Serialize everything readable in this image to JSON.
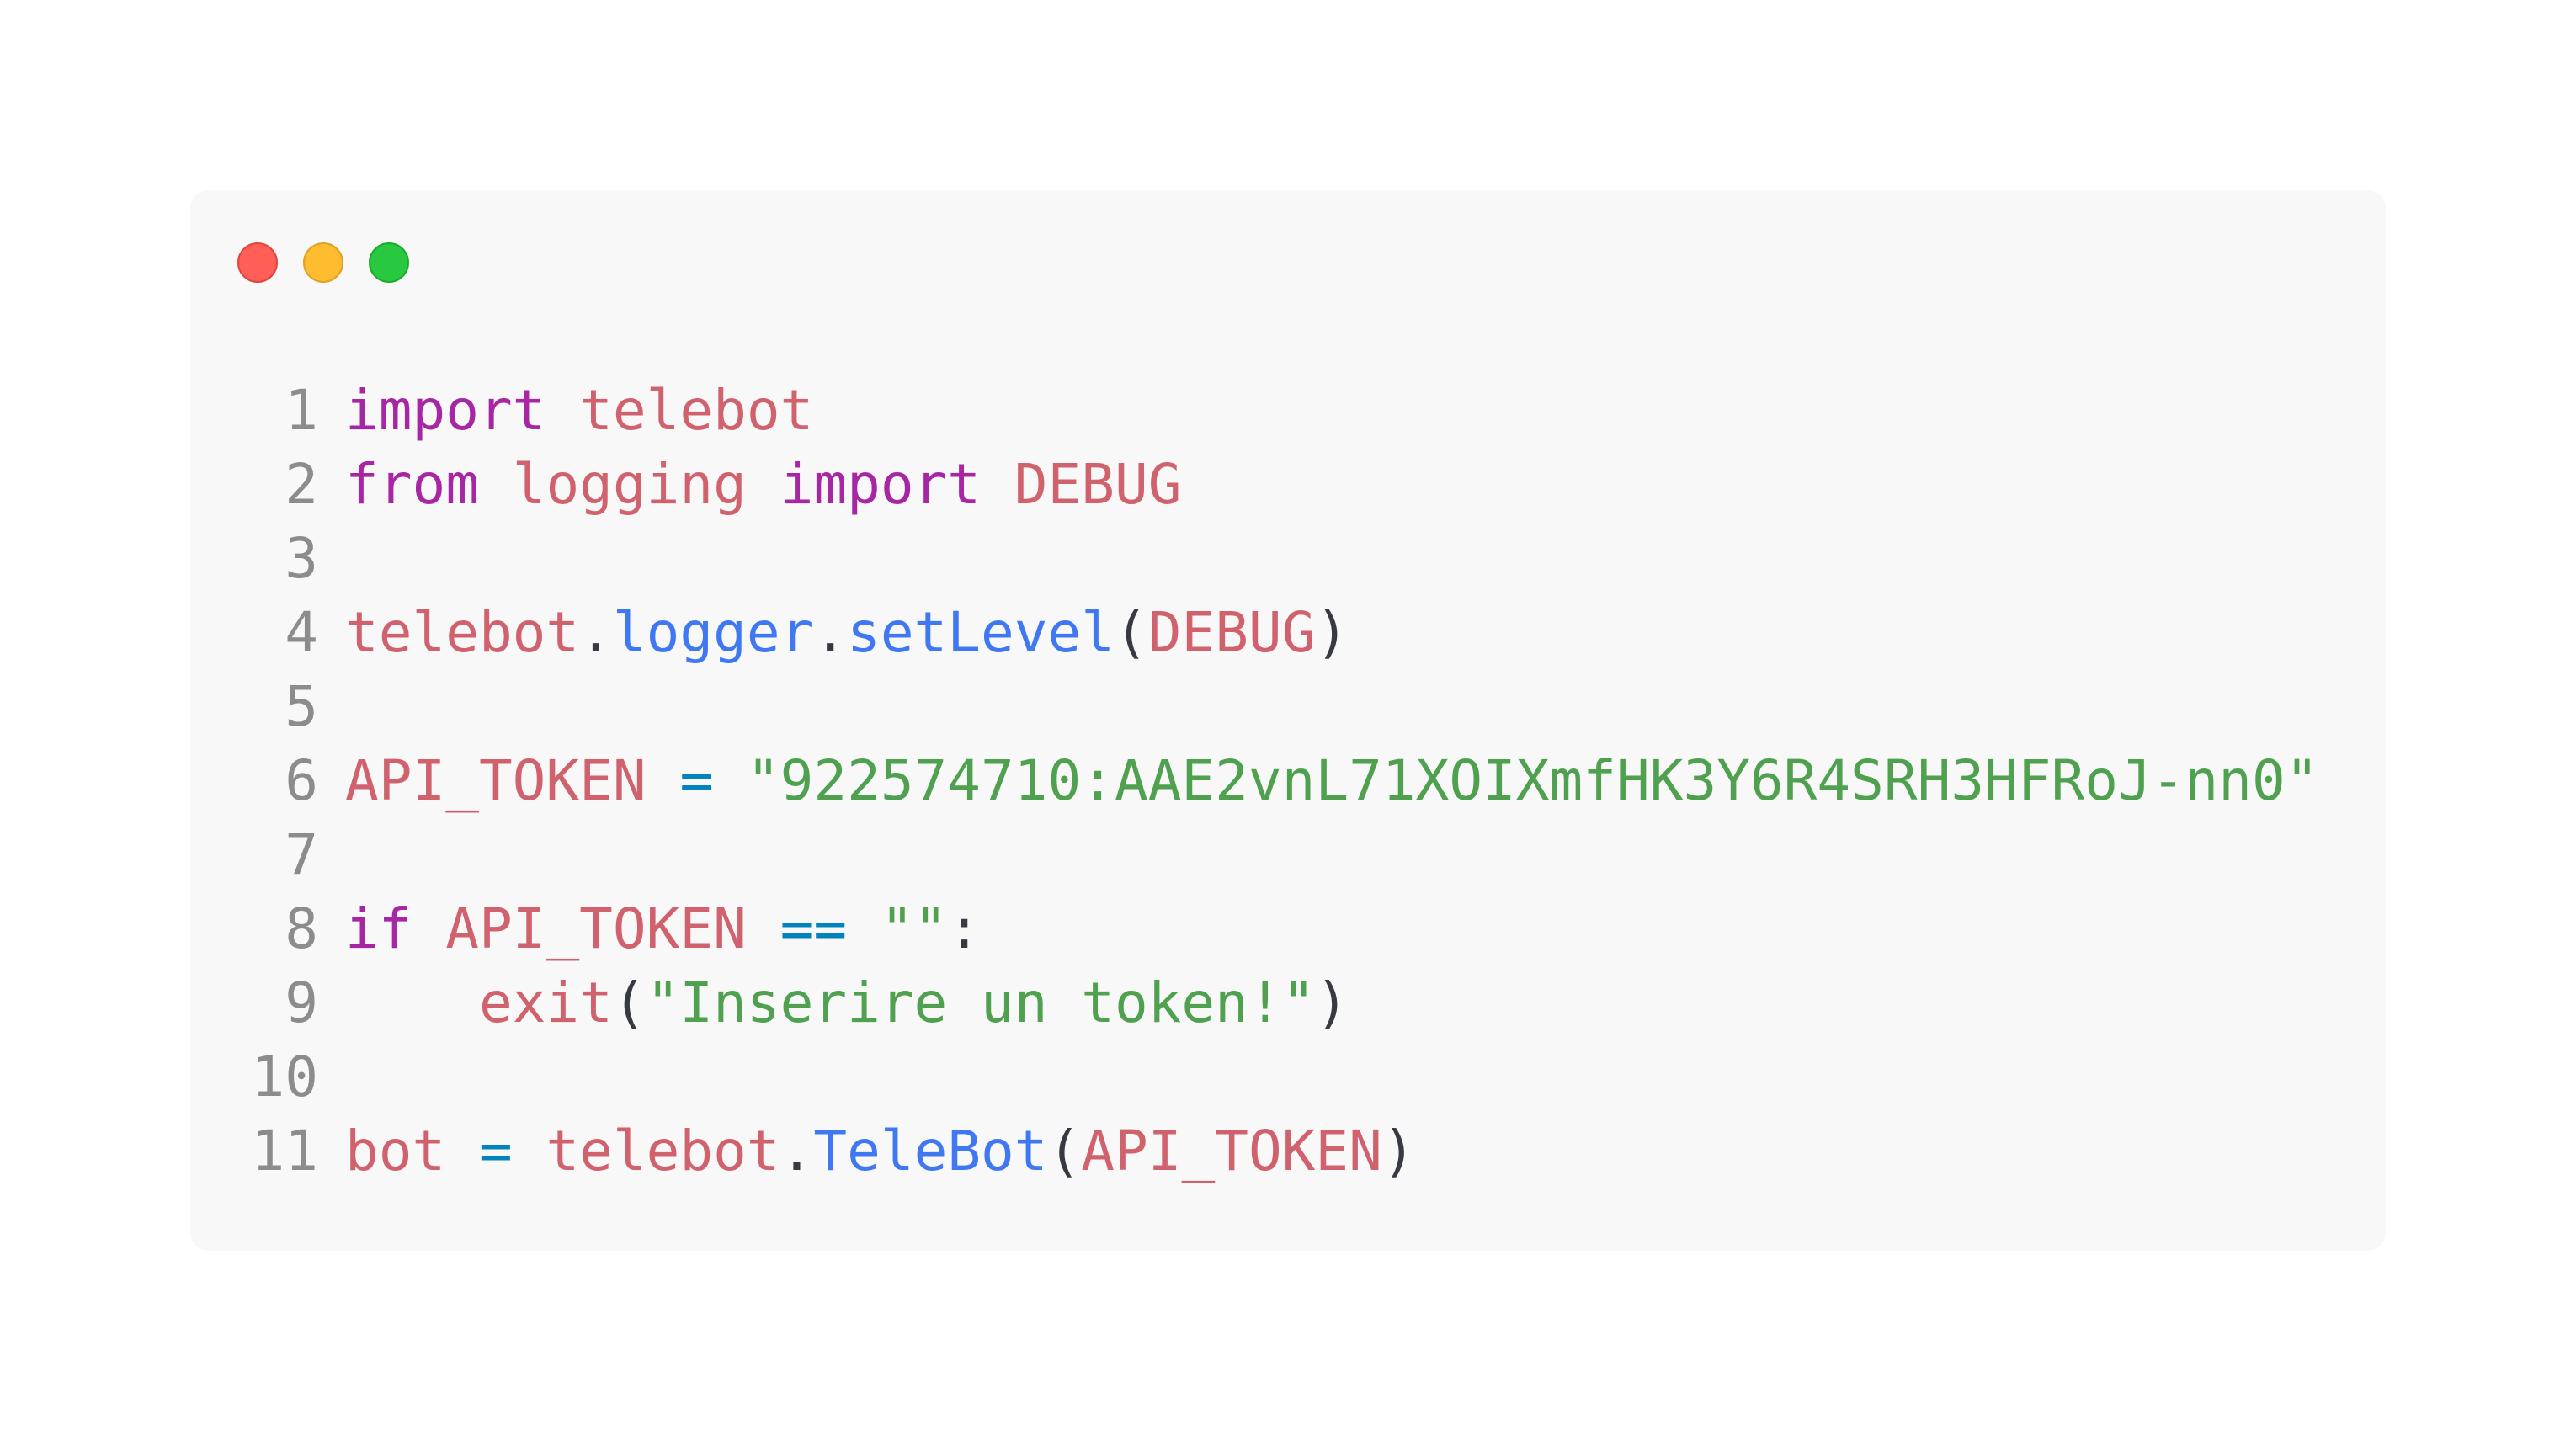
{
  "colors": {
    "keyword": "#a626a4",
    "identifier": "#d0626e",
    "function": "#4078f2",
    "operator": "#0184bc",
    "string": "#50a14f",
    "punctuation": "#383a42",
    "line_number": "#8c8c8c",
    "window_bg": "#f8f8f8"
  },
  "window_controls": [
    "close",
    "minimize",
    "maximize"
  ],
  "lines": [
    {
      "num": "1",
      "tokens": [
        {
          "t": "import",
          "c": "kw"
        },
        {
          "t": " ",
          "c": "pn"
        },
        {
          "t": "telebot",
          "c": "id"
        }
      ]
    },
    {
      "num": "2",
      "tokens": [
        {
          "t": "from",
          "c": "kw"
        },
        {
          "t": " ",
          "c": "pn"
        },
        {
          "t": "logging",
          "c": "id"
        },
        {
          "t": " ",
          "c": "pn"
        },
        {
          "t": "import",
          "c": "kw"
        },
        {
          "t": " ",
          "c": "pn"
        },
        {
          "t": "DEBUG",
          "c": "id"
        }
      ]
    },
    {
      "num": "3",
      "tokens": []
    },
    {
      "num": "4",
      "tokens": [
        {
          "t": "telebot",
          "c": "id"
        },
        {
          "t": ".",
          "c": "pn"
        },
        {
          "t": "logger",
          "c": "fn"
        },
        {
          "t": ".",
          "c": "pn"
        },
        {
          "t": "setLevel",
          "c": "fn"
        },
        {
          "t": "(",
          "c": "pn"
        },
        {
          "t": "DEBUG",
          "c": "id"
        },
        {
          "t": ")",
          "c": "pn"
        }
      ]
    },
    {
      "num": "5",
      "tokens": []
    },
    {
      "num": "6",
      "tokens": [
        {
          "t": "API_TOKEN",
          "c": "id"
        },
        {
          "t": " ",
          "c": "pn"
        },
        {
          "t": "=",
          "c": "op"
        },
        {
          "t": " ",
          "c": "pn"
        },
        {
          "t": "\"922574710:AAE2vnL71XOIXmfHK3Y6R4SRH3HFRoJ-nn0\"",
          "c": "str"
        }
      ]
    },
    {
      "num": "7",
      "tokens": []
    },
    {
      "num": "8",
      "tokens": [
        {
          "t": "if",
          "c": "kw"
        },
        {
          "t": " ",
          "c": "pn"
        },
        {
          "t": "API_TOKEN",
          "c": "id"
        },
        {
          "t": " ",
          "c": "pn"
        },
        {
          "t": "==",
          "c": "op"
        },
        {
          "t": " ",
          "c": "pn"
        },
        {
          "t": "\"\"",
          "c": "str"
        },
        {
          "t": ":",
          "c": "pn"
        }
      ]
    },
    {
      "num": "9",
      "tokens": [
        {
          "t": "    ",
          "c": "pn"
        },
        {
          "t": "exit",
          "c": "id"
        },
        {
          "t": "(",
          "c": "pn"
        },
        {
          "t": "\"Inserire un token!\"",
          "c": "str"
        },
        {
          "t": ")",
          "c": "pn"
        }
      ]
    },
    {
      "num": "10",
      "tokens": []
    },
    {
      "num": "11",
      "tokens": [
        {
          "t": "bot",
          "c": "id"
        },
        {
          "t": " ",
          "c": "pn"
        },
        {
          "t": "=",
          "c": "op"
        },
        {
          "t": " ",
          "c": "pn"
        },
        {
          "t": "telebot",
          "c": "id"
        },
        {
          "t": ".",
          "c": "pn"
        },
        {
          "t": "TeleBot",
          "c": "fn"
        },
        {
          "t": "(",
          "c": "pn"
        },
        {
          "t": "API_TOKEN",
          "c": "id"
        },
        {
          "t": ")",
          "c": "pn"
        }
      ]
    }
  ]
}
